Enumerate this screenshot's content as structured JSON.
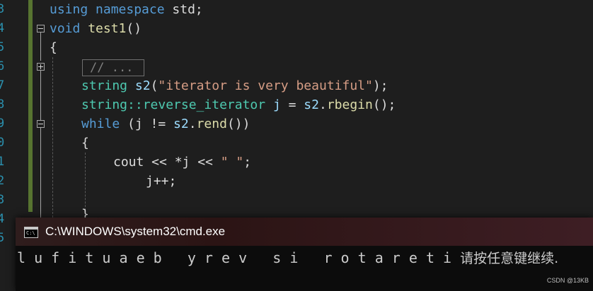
{
  "editor": {
    "line_numbers": [
      "3",
      "4",
      "5",
      "6",
      "7",
      "8",
      "9",
      "0",
      "1",
      "2",
      "3",
      "4",
      "5"
    ],
    "collapsed_block": "// ...",
    "lines": {
      "using": {
        "kw1": "using",
        "kw2": "namespace",
        "rest": " std;"
      },
      "func": {
        "kw": "void",
        "name": "test1",
        "parens": "()"
      },
      "open_brace": "{",
      "string_decl": {
        "type": "string",
        "var": "s2",
        "open": "(",
        "literal": "\"iterator is very beautiful\"",
        "close": ");"
      },
      "iter_decl": {
        "type": "string::reverse_iterator",
        "var": "j",
        "eq": " = ",
        "obj": "s2",
        "dot": ".",
        "method": "rbegin",
        "tail": "();"
      },
      "while_line": {
        "kw": "while",
        "open": " (j != ",
        "obj": "s2",
        "dot": ".",
        "method": "rend",
        "tail": "())"
      },
      "inner_brace": "{",
      "cout_line": {
        "text1": "cout << *j << ",
        "literal": "\" \"",
        "tail": ";"
      },
      "incr_line": "j++;",
      "close_brace": "}"
    }
  },
  "console": {
    "icon": "cmd-icon",
    "title": "C:\\WINDOWS\\system32\\cmd.exe",
    "output": "l u f i t u a e b   y r e v   s i   r o t a r e t i ",
    "prompt": "请按任意键继续.",
    "colors": {
      "title_bg": "#2b1414",
      "text": "#cccccc"
    }
  },
  "watermark": "CSDN @13KB"
}
